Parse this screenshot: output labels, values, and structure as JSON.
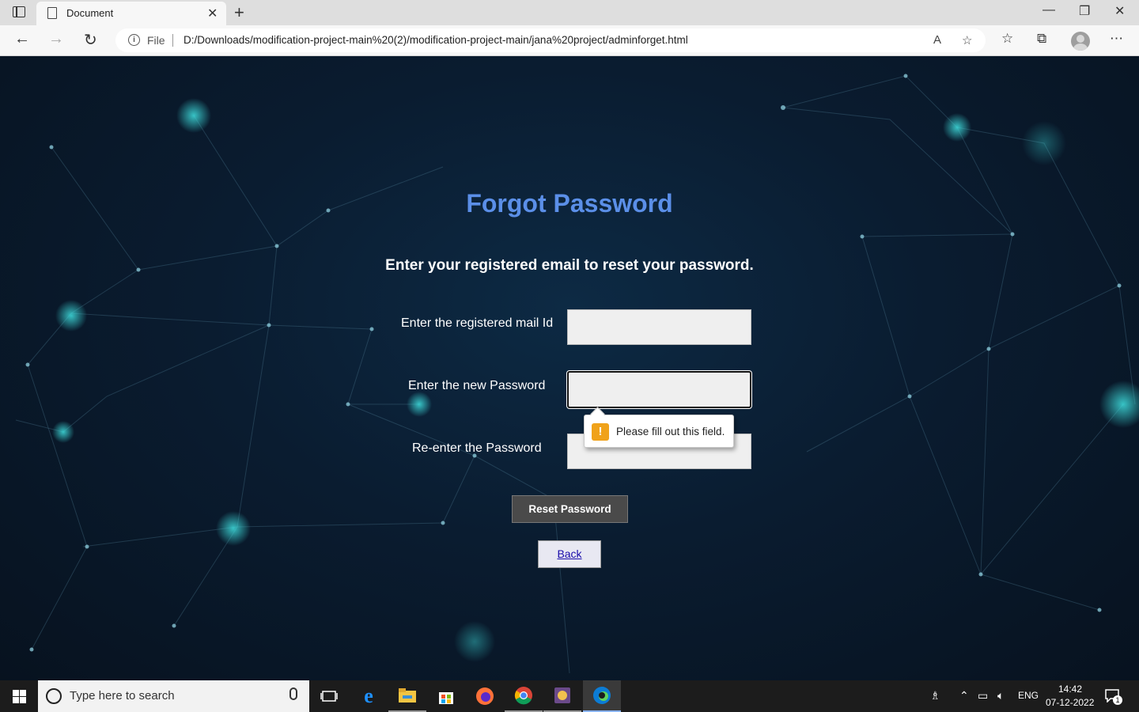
{
  "browser": {
    "tab_title": "Document",
    "address_prefix": "File",
    "url": "D:/Downloads/modification-project-main%20(2)/modification-project-main/jana%20project/adminforget.html"
  },
  "page": {
    "title": "Forgot Password",
    "subtitle": "Enter your registered email to reset your password.",
    "fields": [
      {
        "label": "Enter the registered mail Id",
        "value": ""
      },
      {
        "label": "Enter the new Password",
        "value": ""
      },
      {
        "label": "Re-enter the Password",
        "value": ""
      }
    ],
    "validation_message": "Please fill out this field.",
    "reset_button": "Reset Password",
    "back_link": "Back"
  },
  "taskbar": {
    "search_placeholder": "Type here to search",
    "language": "ENG",
    "time": "14:42",
    "date": "07-12-2022",
    "notification_count": "1"
  }
}
